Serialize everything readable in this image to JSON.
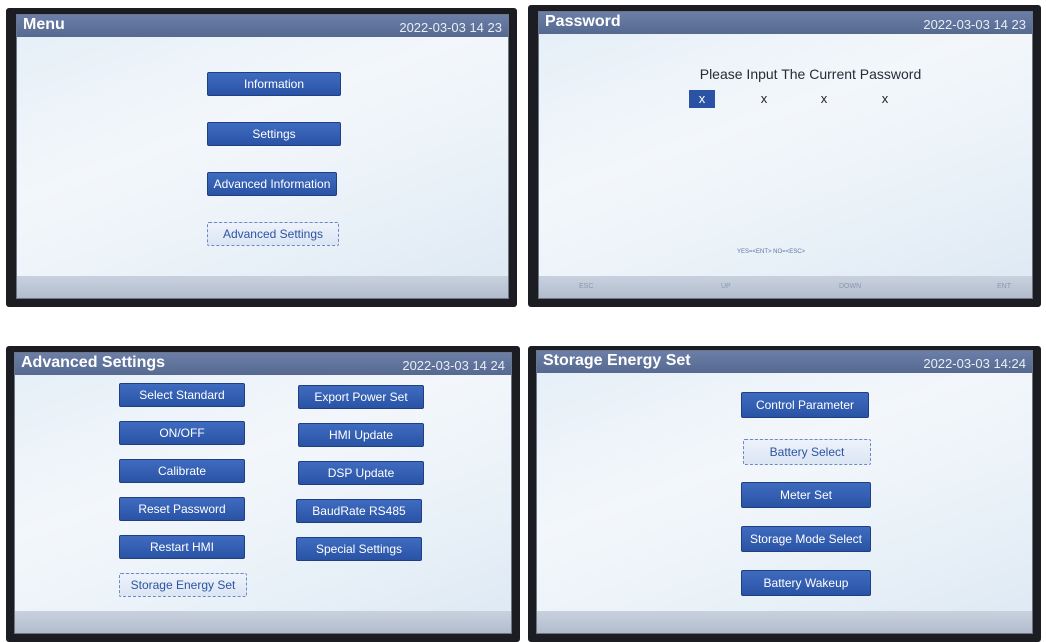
{
  "screens": {
    "menu": {
      "title": "Menu",
      "datetime": "2022-03-03  14 23",
      "buttons": [
        "Information",
        "Settings",
        "Advanced Information",
        "Advanced Settings"
      ]
    },
    "password": {
      "title": "Password",
      "datetime": "2022-03-03  14 23",
      "prompt": "Please Input The Current Password",
      "chars": [
        "x",
        "x",
        "x",
        "x"
      ],
      "hint": "YES=<ENT>  NO=<ESC>",
      "footer_keys": [
        "ESC",
        "UP",
        "DOWN",
        "ENT"
      ]
    },
    "advanced": {
      "title": "Advanced Settings",
      "datetime": "2022-03-03  14 24",
      "buttons": [
        "Select Standard",
        "Export Power Set",
        "ON/OFF",
        "HMI Update",
        "Calibrate",
        "DSP Update",
        "Reset Password",
        "BaudRate RS485",
        "Restart HMI",
        "Special Settings",
        "Storage Energy Set"
      ]
    },
    "storage": {
      "title": "Storage Energy Set",
      "datetime": "2022-03-03  14:24",
      "buttons": [
        "Control Parameter",
        "Battery Select",
        "Meter Set",
        "Storage Mode Select",
        "Battery Wakeup"
      ]
    }
  },
  "colors": {
    "title_bar": "#5e71a0",
    "button": "#2f5bb0",
    "selected_button": "#e6edf7"
  }
}
